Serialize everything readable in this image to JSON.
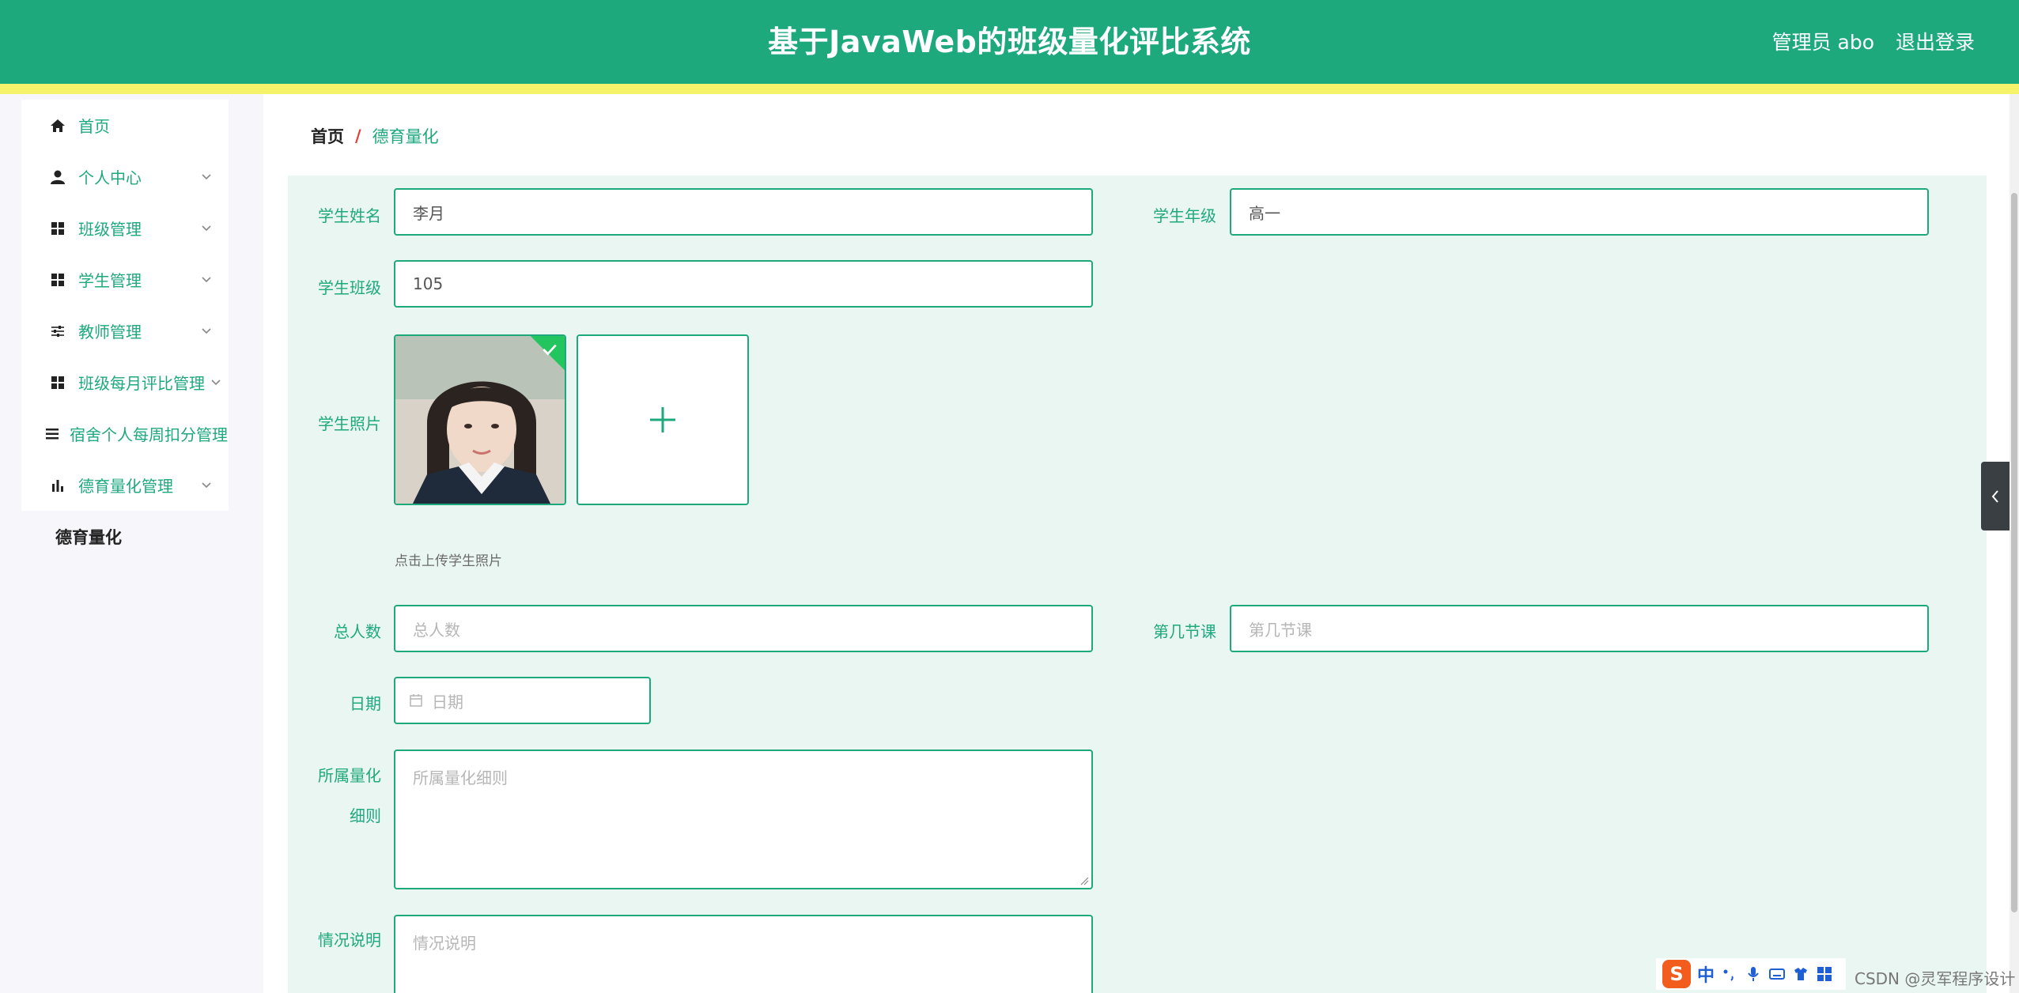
{
  "header": {
    "title": "基于JavaWeb的班级量化评比系统",
    "user": "管理员 abo",
    "logout": "退出登录"
  },
  "sidebar": {
    "items": [
      {
        "label": "首页",
        "icon": "home-icon"
      },
      {
        "label": "个人中心",
        "icon": "user-icon"
      },
      {
        "label": "班级管理",
        "icon": "grid-icon"
      },
      {
        "label": "学生管理",
        "icon": "grid-icon"
      },
      {
        "label": "教师管理",
        "icon": "sliders-icon"
      },
      {
        "label": "班级每月评比管理",
        "icon": "grid-icon"
      },
      {
        "label": "宿舍个人每周扣分管理",
        "icon": "list-icon"
      },
      {
        "label": "德育量化管理",
        "icon": "bar-chart-icon"
      }
    ],
    "active_sub": "德育量化"
  },
  "breadcrumb": {
    "home": "首页",
    "separator": "/",
    "current": "德育量化"
  },
  "form": {
    "student_name": {
      "label": "学生姓名",
      "value": "李月"
    },
    "student_grade": {
      "label": "学生年级",
      "value": "高一"
    },
    "student_class": {
      "label": "学生班级",
      "value": "105"
    },
    "student_photo": {
      "label": "学生照片",
      "hint": "点击上传学生照片"
    },
    "total_people": {
      "label": "总人数",
      "placeholder": "总人数"
    },
    "lesson_no": {
      "label": "第几节课",
      "placeholder": "第几节课"
    },
    "date": {
      "label": "日期",
      "placeholder": "日期"
    },
    "rule": {
      "label_line1": "所属量化",
      "label_line2": "细则",
      "placeholder": "所属量化细则"
    },
    "remark": {
      "label": "情况说明",
      "placeholder": "情况说明"
    }
  },
  "colors": {
    "primary": "#1ea97c",
    "stripe": "#f6f36a",
    "panel": "#eaf6f1",
    "breadcrumb_sep": "#e0413a"
  },
  "taskbar": {
    "ime_logo": "S",
    "ime_mode": "中",
    "watermark": "CSDN @灵军程序设计"
  }
}
